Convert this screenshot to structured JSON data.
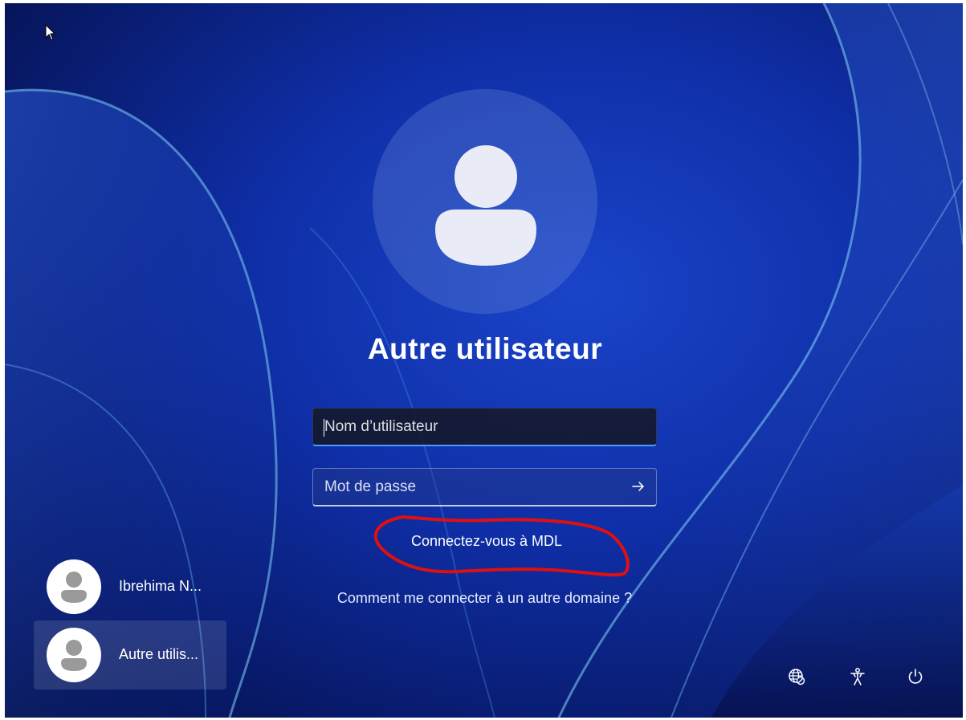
{
  "login": {
    "title": "Autre utilisateur",
    "username_placeholder": "Nom d’utilisateur",
    "password_placeholder": "Mot de passe",
    "sign_in_to_domain": "Connectez-vous à MDL",
    "other_domain_help": "Comment me connecter à un autre domaine ?"
  },
  "users": [
    {
      "name": "Ibrehima N...",
      "selected": false
    },
    {
      "name": "Autre utilis...",
      "selected": true
    }
  ],
  "system_icons": [
    "network-icon",
    "accessibility-icon",
    "power-icon"
  ],
  "colors": {
    "background": "#0f2fa8",
    "focus_underline": "#4a9bff",
    "annotation": "#e01010"
  }
}
